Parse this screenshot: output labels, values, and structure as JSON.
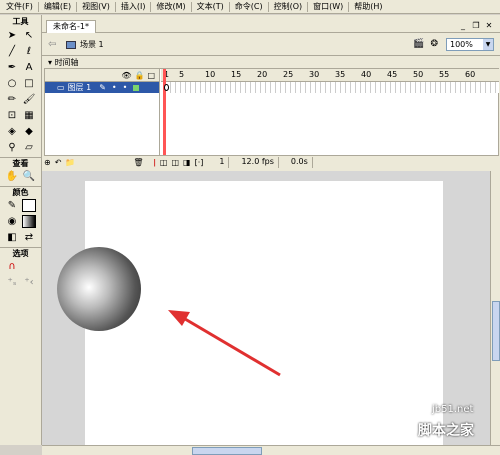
{
  "menu": [
    "文件(F)",
    "编辑(E)",
    "视图(V)",
    "插入(I)",
    "修改(M)",
    "文本(T)",
    "命令(C)",
    "控制(O)",
    "窗口(W)",
    "帮助(H)"
  ],
  "toolbox": {
    "title": "工具",
    "view_label": "查看",
    "colors_label": "颜色",
    "options_label": "选项"
  },
  "document": {
    "tab_title": "未命名-1*",
    "scene": "场景 1",
    "zoom": "100%"
  },
  "timeline": {
    "title": "时间轴",
    "layer_name": "图层 1",
    "frame_ticks": [
      "1",
      "5",
      "10",
      "15",
      "20",
      "25",
      "30",
      "35",
      "40",
      "45",
      "50",
      "55",
      "60"
    ],
    "current_frame": "1",
    "fps": "12.0 fps",
    "elapsed": "0.0s"
  },
  "watermark": {
    "site": "jb51.net",
    "brand": "脚本之家"
  },
  "colors": {
    "arrow": "#e03030",
    "layer_highlight": "#2d58a8"
  }
}
